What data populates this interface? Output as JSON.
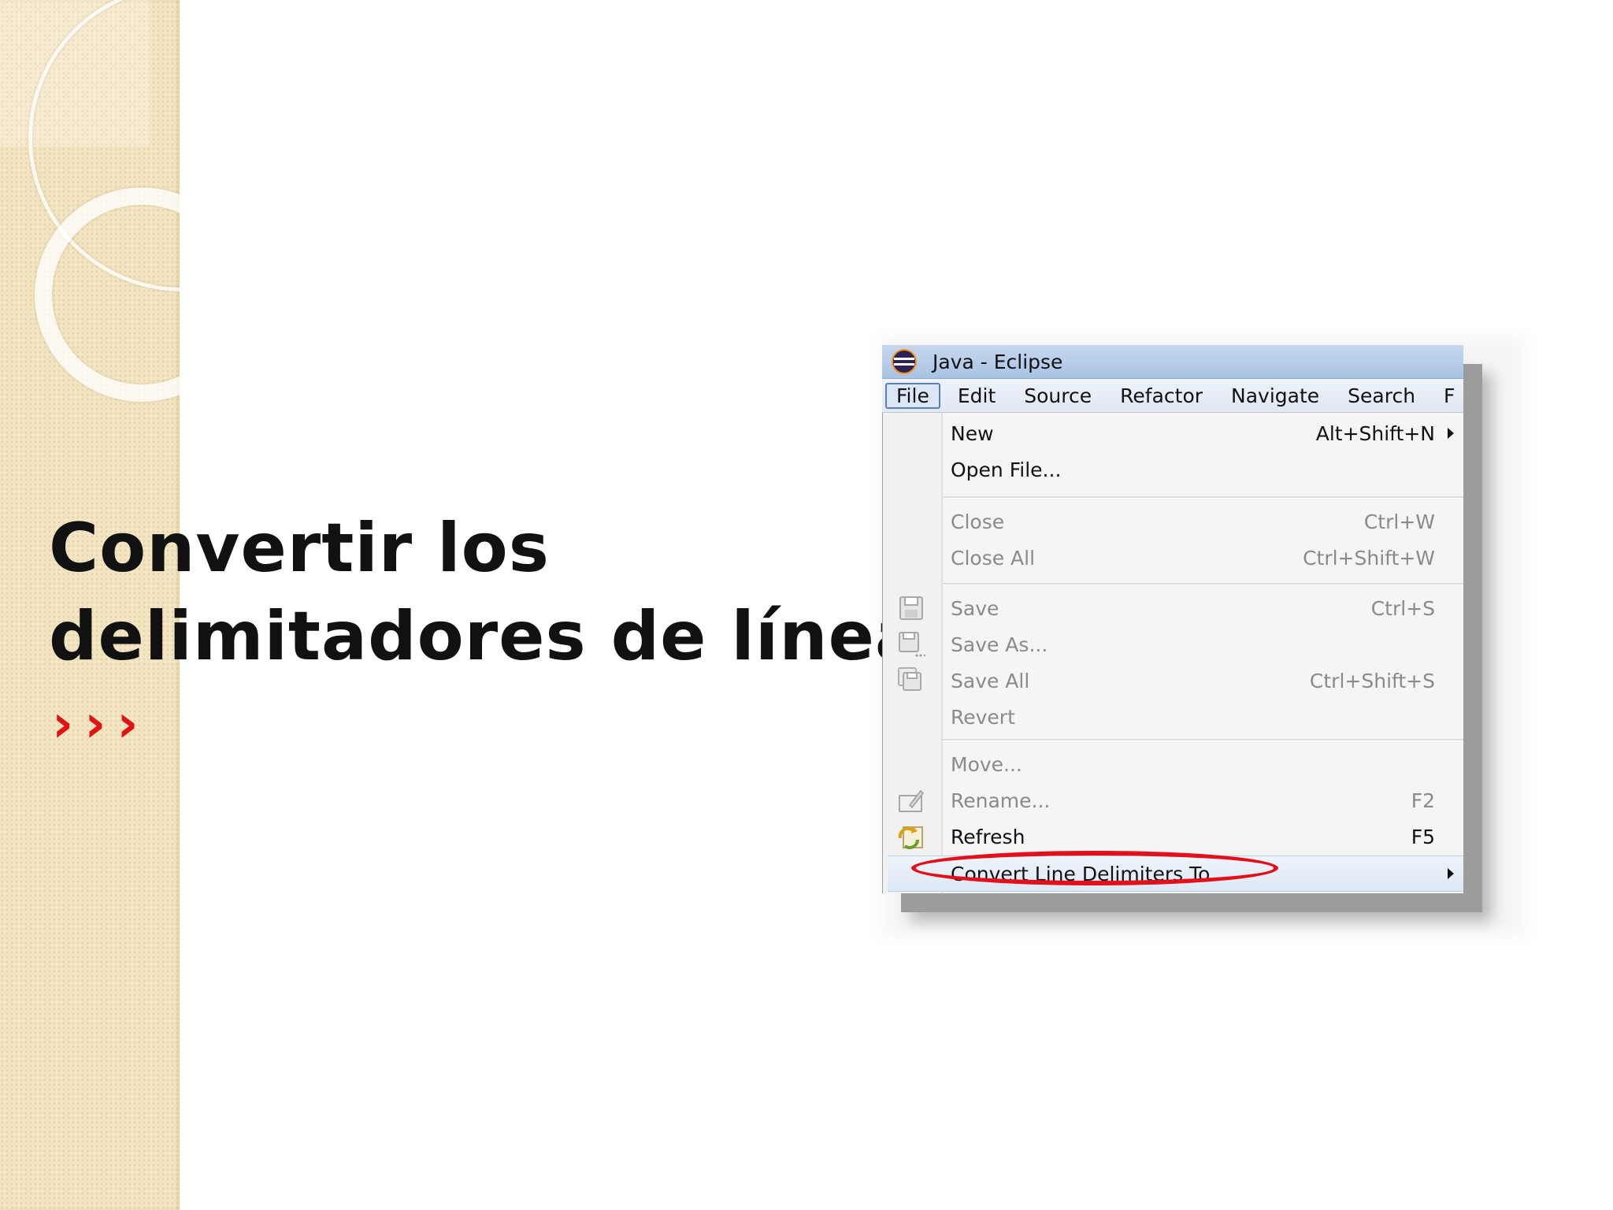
{
  "slide": {
    "title_line1": "Convertir los",
    "title_line2": "delimitadores de línea",
    "arrows": "›››",
    "accent_color": "#e01313"
  },
  "window": {
    "title": "Java - Eclipse",
    "menubar": [
      "File",
      "Edit",
      "Source",
      "Refactor",
      "Navigate",
      "Search",
      "F"
    ],
    "active_menu": "File"
  },
  "file_menu": {
    "items": [
      {
        "label": "New",
        "accel": "Alt+Shift+N",
        "submenu": true,
        "enabled": true
      },
      {
        "label": "Open File...",
        "accel": "",
        "enabled": true
      },
      {
        "label": "Close",
        "accel": "Ctrl+W",
        "enabled": false
      },
      {
        "label": "Close All",
        "accel": "Ctrl+Shift+W",
        "enabled": false
      },
      {
        "label": "Save",
        "accel": "Ctrl+S",
        "enabled": false,
        "icon": "save-icon"
      },
      {
        "label": "Save As...",
        "accel": "",
        "enabled": false,
        "icon": "save-as-icon"
      },
      {
        "label": "Save All",
        "accel": "Ctrl+Shift+S",
        "enabled": false,
        "icon": "save-all-icon"
      },
      {
        "label": "Revert",
        "accel": "",
        "enabled": false
      },
      {
        "label": "Move...",
        "accel": "",
        "enabled": false
      },
      {
        "label": "Rename...",
        "accel": "F2",
        "enabled": false,
        "icon": "rename-icon"
      },
      {
        "label": "Refresh",
        "accel": "F5",
        "enabled": true,
        "icon": "refresh-icon"
      },
      {
        "label": "Convert Line Delimiters To",
        "accel": "",
        "submenu": true,
        "enabled": true,
        "highlighted": true
      }
    ]
  }
}
